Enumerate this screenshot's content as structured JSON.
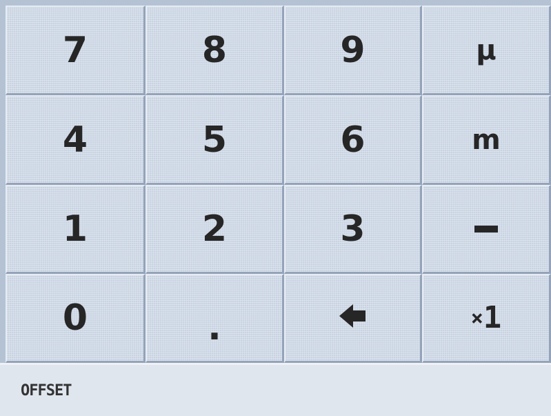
{
  "keypad": {
    "keys": [
      {
        "label": "7"
      },
      {
        "label": "8"
      },
      {
        "label": "9"
      },
      {
        "label": "µ"
      },
      {
        "label": "4"
      },
      {
        "label": "5"
      },
      {
        "label": "6"
      },
      {
        "label": "m"
      },
      {
        "label": "1"
      },
      {
        "label": "2"
      },
      {
        "label": "3"
      },
      {
        "label": "–"
      },
      {
        "label": "0"
      },
      {
        "label": "."
      },
      {
        "label": "backspace-arrow",
        "icon": "left-arrow-icon"
      },
      {
        "label": "×1",
        "icon": "times-one"
      }
    ]
  },
  "status": {
    "field_name": "OFFSET"
  },
  "colors": {
    "key_face": "#c8d3e2",
    "grid_line": "#94a3b9",
    "text": "#262626",
    "status_bar": "#dfe6ee"
  }
}
